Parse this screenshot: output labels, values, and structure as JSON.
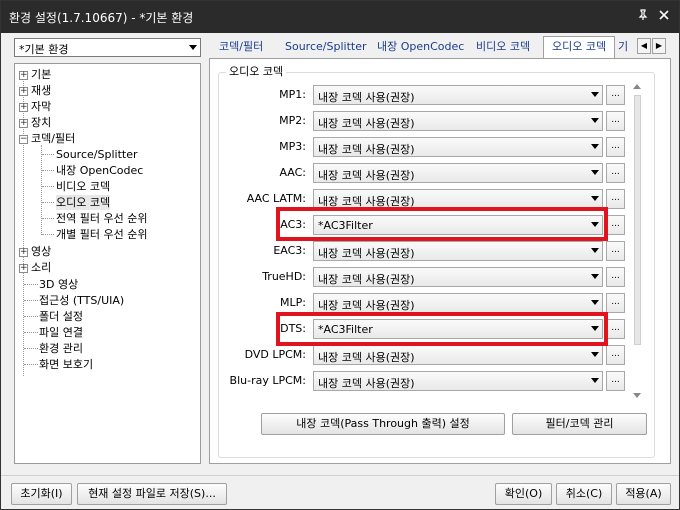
{
  "window": {
    "title": "환경 설정(1.7.10667) - *기본 환경",
    "pin_icon": "pin-icon",
    "close_icon": "close-icon"
  },
  "profile": {
    "selected": "*기본 환경"
  },
  "tree": {
    "nodes": [
      {
        "label": "기본",
        "expander": "+"
      },
      {
        "label": "재생",
        "expander": "+"
      },
      {
        "label": "자막",
        "expander": "+"
      },
      {
        "label": "장치",
        "expander": "+"
      },
      {
        "label": "코덱/필터",
        "expander": "−"
      },
      {
        "label": "Source/Splitter"
      },
      {
        "label": "내장 OpenCodec"
      },
      {
        "label": "비디오 코덱"
      },
      {
        "label": "오디오 코덱",
        "selected": true
      },
      {
        "label": "전역 필터 우선 순위"
      },
      {
        "label": "개별 필터 우선 순위"
      },
      {
        "label": "영상",
        "expander": "+"
      },
      {
        "label": "소리",
        "expander": "+"
      },
      {
        "label": "3D 영상"
      },
      {
        "label": "접근성 (TTS/UIA)"
      },
      {
        "label": "폴더 설정"
      },
      {
        "label": "파일 연결"
      },
      {
        "label": "환경 관리"
      },
      {
        "label": "화면 보호기"
      }
    ]
  },
  "tabs": [
    "코덱/필터",
    "Source/Splitter",
    "내장 OpenCodec",
    "비디오 코덱",
    "오디오 코덱",
    "기"
  ],
  "active_tab": "오디오 코덱",
  "group_title": "오디오 코덱",
  "codecs": [
    {
      "label": "MP1:",
      "value": "내장 코덱 사용(권장)"
    },
    {
      "label": "MP2:",
      "value": "내장 코덱 사용(권장)"
    },
    {
      "label": "MP3:",
      "value": "내장 코덱 사용(권장)"
    },
    {
      "label": "AAC:",
      "value": "내장 코덱 사용(권장)"
    },
    {
      "label": "AAC LATM:",
      "value": "내장 코덱 사용(권장)"
    },
    {
      "label": "AC3:",
      "value": "*AC3Filter",
      "highlighted": true
    },
    {
      "label": "EAC3:",
      "value": "내장 코덱 사용(권장)"
    },
    {
      "label": "TrueHD:",
      "value": "내장 코덱 사용(권장)"
    },
    {
      "label": "MLP:",
      "value": "내장 코덱 사용(권장)"
    },
    {
      "label": "DTS:",
      "value": "*AC3Filter",
      "highlighted": true
    },
    {
      "label": "DVD LPCM:",
      "value": "내장 코덱 사용(권장)"
    },
    {
      "label": "Blu-ray LPCM:",
      "value": "내장 코덱 사용(권장)"
    }
  ],
  "ellipsis_label": "...",
  "panel_buttons": {
    "passthrough": "내장 코덱(Pass Through 출력) 설정",
    "filter_manage": "필터/코덱 관리"
  },
  "footer": {
    "reset": "초기화(I)",
    "save_current": "현재 설정 파일로 저장(S)...",
    "ok": "확인(O)",
    "cancel": "취소(C)",
    "apply": "적용(A)"
  },
  "colors": {
    "highlight": "#e0141e",
    "titlebar": "#2b2b2b",
    "tab_text": "#1a3b8c"
  }
}
